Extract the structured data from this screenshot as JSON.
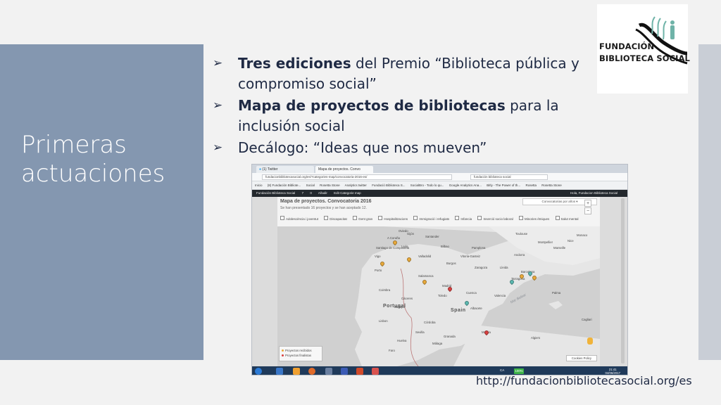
{
  "slide": {
    "title_line1": "Primeras",
    "title_line2": "actuaciones",
    "footer_url": "http://fundacionbibliotecasocial.org/es"
  },
  "logo": {
    "line1": "FUNDACIÓN",
    "line2": "BIBLIOTECA SOCIAL"
  },
  "bullets": [
    {
      "bold": "Tres ediciones",
      "text": " del Premio “Biblioteca pública y compromiso social”"
    },
    {
      "bold": "Mapa de proyectos de bibliotecas",
      "text": " para la inclusión social"
    },
    {
      "bold": "",
      "text": "Decálogo: “Ideas que nos mueven”"
    }
  ],
  "screenshot": {
    "tabs": [
      "(1) Twitter",
      "Mapa de proyectos. Convo"
    ],
    "url": "fundacionbibliotecasocial.org/es/?categories-map/convocatoria-2016-es/",
    "search": "fundación biblioteca social",
    "bookmarks": [
      "Inicio",
      "(8) Fundación Bibliote...",
      "Social",
      "Rosetta Stone",
      "Analytics twitter",
      "Fundació Biblioteca S...",
      "SocialBro - Todo lo qu...",
      "Google Analytics Ana...",
      "Bitly - The Power of th...",
      "Rosetta",
      "Rosetta Stone"
    ],
    "admin_items": [
      "Fundación Biblioteca Social",
      "7",
      "0",
      "Añadir",
      "Edit Categorie map"
    ],
    "admin_right": "Hola, Fundacion Biblioteca Social",
    "map_title": "Mapa de proyectos. Convocatoria 2016",
    "map_subtitle": "Se han presentado 16 proyectos y se han aceptado 12.",
    "select_label": "Convocatorias por años",
    "filters": [
      "Adolescència i joventut",
      "Discapacitat",
      "Gent gran",
      "Hospitalitzacions",
      "Immigració i refugiats",
      "Infancia",
      "Inserció socio laboral",
      "Minories ètniques",
      "Salut mental"
    ],
    "cities": [
      {
        "name": "Toulouse"
      },
      {
        "name": "Montpellier"
      },
      {
        "name": "Monaco"
      },
      {
        "name": "Nice"
      },
      {
        "name": "Marseille"
      },
      {
        "name": "Andorra"
      },
      {
        "name": "Bilbao"
      },
      {
        "name": "Santander"
      },
      {
        "name": "Gijón"
      },
      {
        "name": "A Coruña"
      },
      {
        "name": "Santiago de Compostela"
      },
      {
        "name": "Vigo"
      },
      {
        "name": "Porto"
      },
      {
        "name": "Valladolid"
      },
      {
        "name": "Salamanca"
      },
      {
        "name": "Zaragoza"
      },
      {
        "name": "Barcelona"
      },
      {
        "name": "Madrid"
      },
      {
        "name": "Toledo"
      },
      {
        "name": "Valencia"
      },
      {
        "name": "Palma"
      },
      {
        "name": "Lisbon"
      },
      {
        "name": "Córdoba"
      },
      {
        "name": "Sevilla"
      },
      {
        "name": "Granada"
      },
      {
        "name": "Murcia"
      },
      {
        "name": "Málaga"
      },
      {
        "name": "Algiers"
      },
      {
        "name": "Vitoria-Gasteiz"
      },
      {
        "name": "Burgos"
      },
      {
        "name": "León"
      },
      {
        "name": "Oviedo"
      },
      {
        "name": "Pamplona"
      },
      {
        "name": "Lleida"
      },
      {
        "name": "Tarragona"
      },
      {
        "name": "Cuenca"
      },
      {
        "name": "Albacete"
      },
      {
        "name": "Badajoz"
      },
      {
        "name": "Cáceres"
      },
      {
        "name": "Huelva"
      },
      {
        "name": "Coimbra"
      },
      {
        "name": "Faro"
      },
      {
        "name": "Cagliari"
      }
    ],
    "countries": [
      "Portugal",
      "Spain"
    ],
    "sea_label": "Mar Balear",
    "legend_received": "Proyectos recibidos",
    "legend_finalists": "Proyectos finalistas",
    "cookies": "Cookies Policy",
    "zoom_level": "100%",
    "clock_time": "21:41",
    "clock_date": "04/06/2017",
    "lang": "CA",
    "colors": {
      "pin_received": "#e8a93a",
      "pin_finalist": "#d84040",
      "pin_other": "#5bb8b0"
    }
  }
}
